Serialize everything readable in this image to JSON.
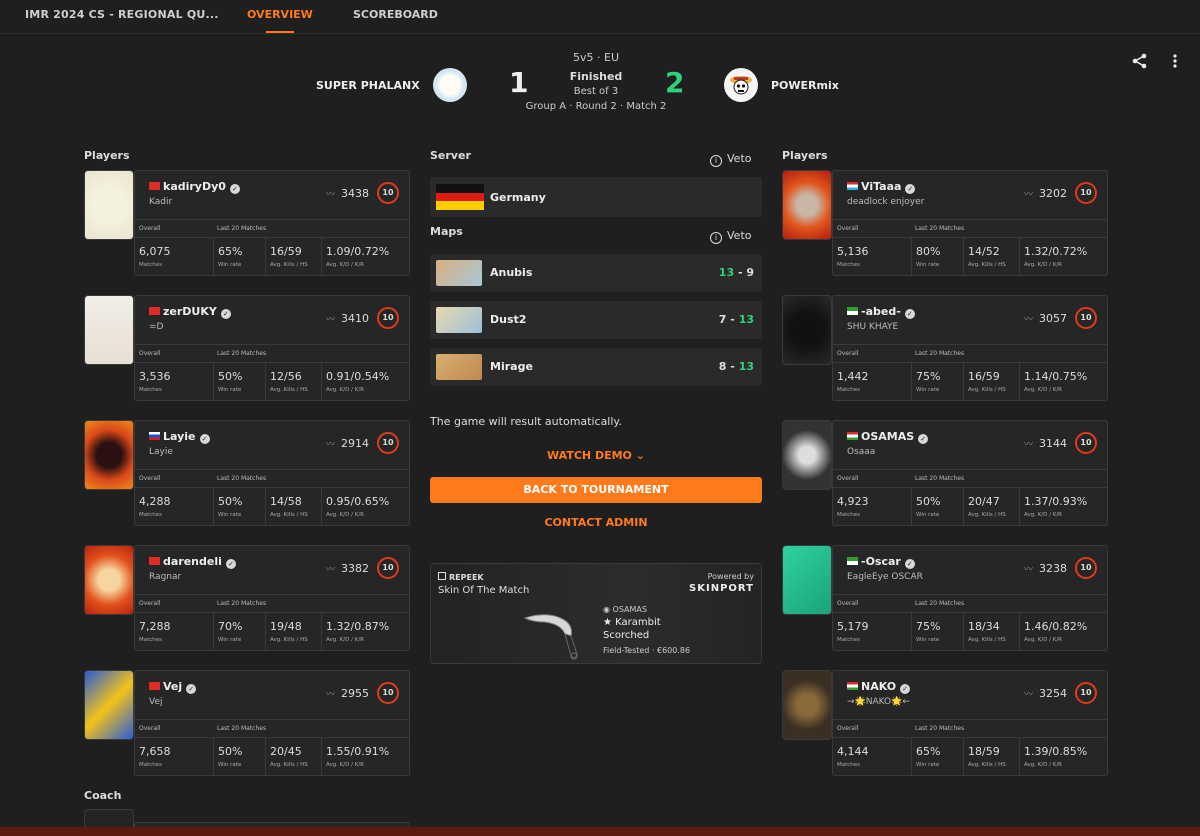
{
  "topbar": {
    "title": "IMR 2024 CS - REGIONAL QU...",
    "tabs": [
      "OVERVIEW",
      "SCOREBOARD"
    ]
  },
  "match": {
    "format": "5v5 · EU",
    "status": "Finished",
    "best_of": "Best of 3",
    "round_info": "Group A · Round 2 · Match 2",
    "team1": {
      "name": "SUPER PHALANX",
      "score": "1"
    },
    "team2": {
      "name": "POWERmix",
      "score": "2"
    }
  },
  "labels": {
    "players": "Players",
    "server": "Server",
    "maps": "Maps",
    "veto": "Veto",
    "coach": "Coach",
    "overall": "Overall",
    "last20": "Last 20 Matches",
    "col_matches": "Matches",
    "col_winrate": "Win rate",
    "col_kills": "Avg. Kills / HS",
    "col_kd": "Avg. K/D / K/R"
  },
  "server": {
    "name": "Germany"
  },
  "maps": [
    {
      "name": "Anubis",
      "left": "13",
      "sep": " - ",
      "right": "9"
    },
    {
      "name": "Dust2",
      "left": "7",
      "sep": " - ",
      "right": "13"
    },
    {
      "name": "Mirage",
      "left": "8",
      "sep": " - ",
      "right": "13"
    }
  ],
  "notice": "The game will result automatically.",
  "actions": {
    "watch_demo": "WATCH DEMO",
    "back": "BACK TO TOURNAMENT",
    "contact": "CONTACT ADMIN"
  },
  "skin": {
    "brand": "REPEEK",
    "title": "Skin Of The Match",
    "powered": "Powered by",
    "sponsor": "SKINPORT",
    "owner": "OSAMAS",
    "item": "★ Karambit",
    "finish": "Scorched",
    "wear_price": "Field-Tested · €600.86"
  },
  "team1_players": [
    {
      "name": "kadiryDy0",
      "sub": "Kadir",
      "elo": "3438",
      "level": "10",
      "matches": "6,075",
      "winrate": "65%",
      "kills": "16/59",
      "kd": "1.09/0.72%"
    },
    {
      "name": "zerDUKY",
      "sub": "=D",
      "elo": "3410",
      "level": "10",
      "matches": "3,536",
      "winrate": "50%",
      "kills": "12/56",
      "kd": "0.91/0.54%"
    },
    {
      "name": "Layie",
      "sub": "Layie",
      "elo": "2914",
      "level": "10",
      "matches": "4,288",
      "winrate": "50%",
      "kills": "14/58",
      "kd": "0.95/0.65%"
    },
    {
      "name": "darendeli",
      "sub": "Ragnar",
      "elo": "3382",
      "level": "10",
      "matches": "7,288",
      "winrate": "70%",
      "kills": "19/48",
      "kd": "1.32/0.87%"
    },
    {
      "name": "Vej",
      "sub": "Vej",
      "elo": "2955",
      "level": "10",
      "matches": "7,658",
      "winrate": "50%",
      "kills": "20/45",
      "kd": "1.55/0.91%"
    }
  ],
  "team2_players": [
    {
      "name": "ViTaaa",
      "sub": "deadlock enjoyer",
      "elo": "3202",
      "level": "10",
      "matches": "5,136",
      "winrate": "80%",
      "kills": "14/52",
      "kd": "1.32/0.72%"
    },
    {
      "name": "-abed-",
      "sub": "SHU KHAYE",
      "elo": "3057",
      "level": "10",
      "matches": "1,442",
      "winrate": "75%",
      "kills": "16/59",
      "kd": "1.14/0.75%"
    },
    {
      "name": "OSAMAS",
      "sub": "Osaaa",
      "elo": "3144",
      "level": "10",
      "matches": "4,923",
      "winrate": "50%",
      "kills": "20/47",
      "kd": "1.37/0.93%"
    },
    {
      "name": "-Oscar",
      "sub": "EagleEye OSCAR",
      "elo": "3238",
      "level": "10",
      "matches": "5,179",
      "winrate": "75%",
      "kills": "18/34",
      "kd": "1.46/0.82%"
    },
    {
      "name": "NAKO",
      "sub": "→🌟NAKO🌟←",
      "elo": "3254",
      "level": "10",
      "matches": "4,144",
      "winrate": "65%",
      "kills": "18/59",
      "kd": "1.39/0.85%"
    }
  ]
}
